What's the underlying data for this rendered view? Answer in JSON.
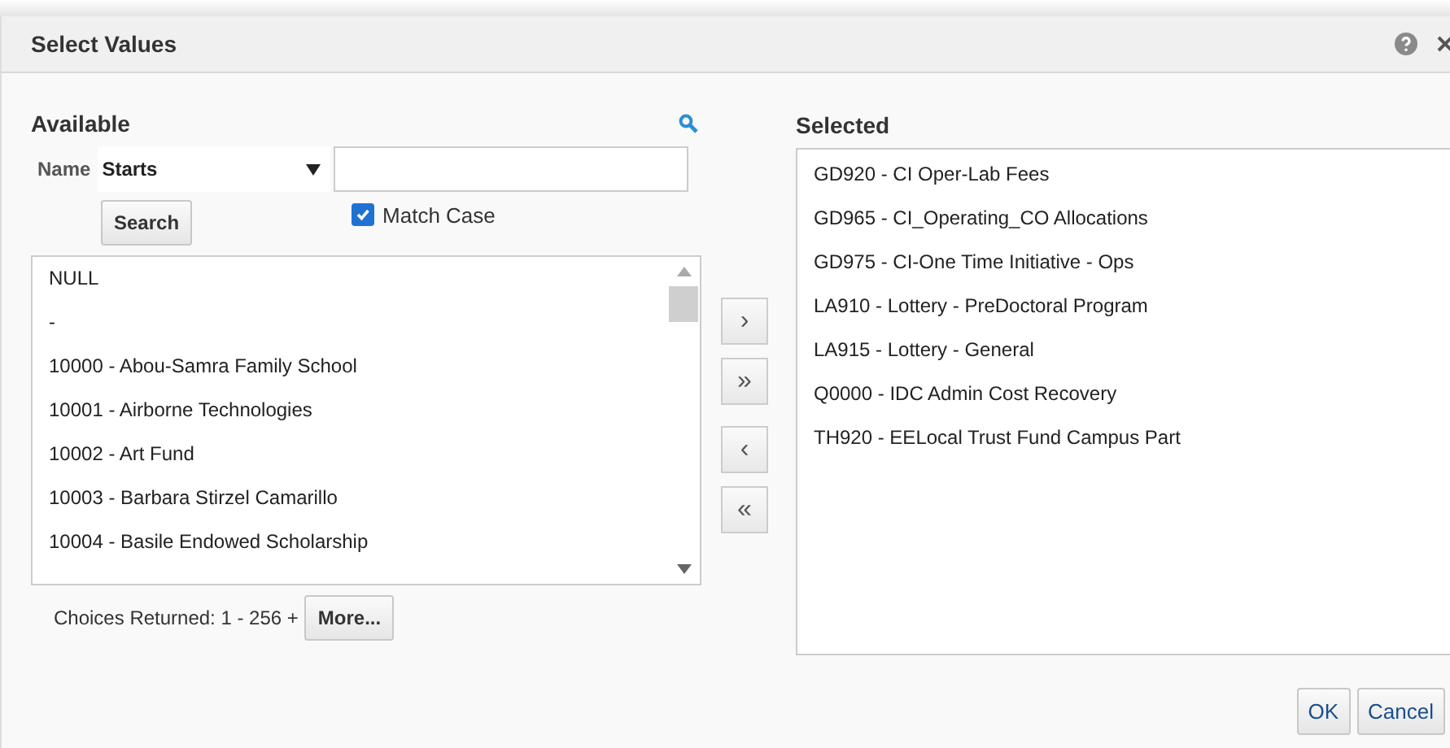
{
  "window": {
    "title": "Select Values"
  },
  "available": {
    "heading": "Available",
    "name_label": "Name",
    "operator": "Starts",
    "search_button": "Search",
    "match_case": {
      "label": "Match Case",
      "checked": true
    },
    "items": [
      "NULL",
      "-",
      "10000 - Abou-Samra Family School",
      "10001 - Airborne Technologies",
      "10002 - Art Fund",
      "10003 - Barbara Stirzel Camarillo",
      "10004 - Basile Endowed Scholarship"
    ],
    "choices_returned": "Choices Returned: 1 - 256 +",
    "more_button": "More..."
  },
  "move_buttons": [
    "›",
    "»",
    "‹",
    "«"
  ],
  "selected": {
    "heading": "Selected",
    "items": [
      "GD920 - CI Oper-Lab Fees",
      "GD965 - CI_Operating_CO Allocations",
      "GD975 - CI-One Time Initiative - Ops",
      "LA910 - Lottery - PreDoctoral Program",
      "LA915 - Lottery - General",
      "Q0000 - IDC Admin Cost Recovery",
      "TH920 - EELocal Trust Fund Campus Part"
    ]
  },
  "buttons": [
    "OK",
    "Cancel"
  ]
}
